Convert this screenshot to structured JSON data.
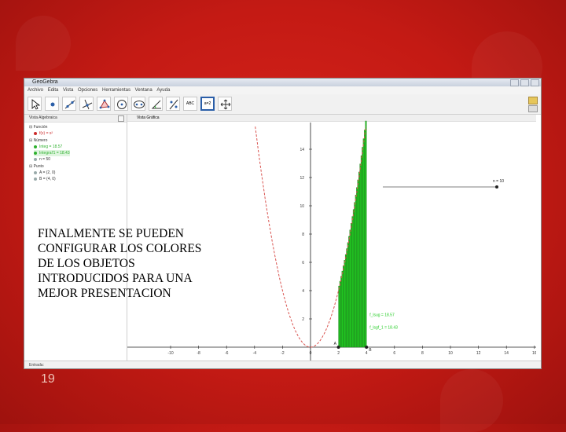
{
  "window": {
    "title": "GeoGebra",
    "menu": [
      "Archivo",
      "Edita",
      "Vista",
      "Opciones",
      "Herramientas",
      "Ventana",
      "Ayuda"
    ]
  },
  "toolbar": {
    "tools": [
      "move-tool",
      "point-tool",
      "line-tool",
      "perpendicular-tool",
      "polygon-tool",
      "circle-tool",
      "ellipse-tool",
      "angle-tool",
      "reflect-tool",
      "text-tool",
      "slider-tool",
      "move-view-tool"
    ],
    "text_tool_label": "ABC",
    "slider_tool_label": "a=2"
  },
  "algebra_view": {
    "title": "Vista Algebraica",
    "groups": [
      {
        "name": "Función",
        "items": [
          {
            "text": "f(x) = x²",
            "color": "#cc2b2b"
          }
        ]
      },
      {
        "name": "Número",
        "items": [
          {
            "text": "Integ = 18.57",
            "color": "#2fb12f"
          },
          {
            "text": "Integral'1 = 18.43",
            "color": "#2fb12f"
          },
          {
            "text": "n = 50",
            "color": "#333333"
          }
        ]
      },
      {
        "name": "Punto",
        "items": [
          {
            "text": "A = (2, 0)",
            "color": "#333333"
          },
          {
            "text": "B = (4, 0)",
            "color": "#333333"
          }
        ]
      }
    ]
  },
  "graphics_view": {
    "title": "Vista Gráfica",
    "slider_label": "n = 10",
    "point_a": "A",
    "point_b": "B",
    "integral_upper": "f_lsug = 18.57",
    "integral_lower": "f_lsgf_1 = 18.43",
    "x_ticks": [
      "-10",
      "-8",
      "-6",
      "-4",
      "-2",
      "0",
      "2",
      "4",
      "6",
      "8",
      "10",
      "12",
      "14",
      "16"
    ],
    "y_ticks": [
      "2",
      "4",
      "6",
      "8",
      "10",
      "12",
      "14"
    ],
    "curve_color": "#d9534f",
    "fill_color": "#22cc22"
  },
  "input_bar": {
    "label": "Entrada:"
  },
  "overlay_text": "FINALMENTE SE PUEDEN\nCONFIGURAR LOS COLORES\nDE LOS OBJETOS\nINTRODUCIDOS PARA UNA\nMEJOR PRESENTACION",
  "slide_number": "19"
}
